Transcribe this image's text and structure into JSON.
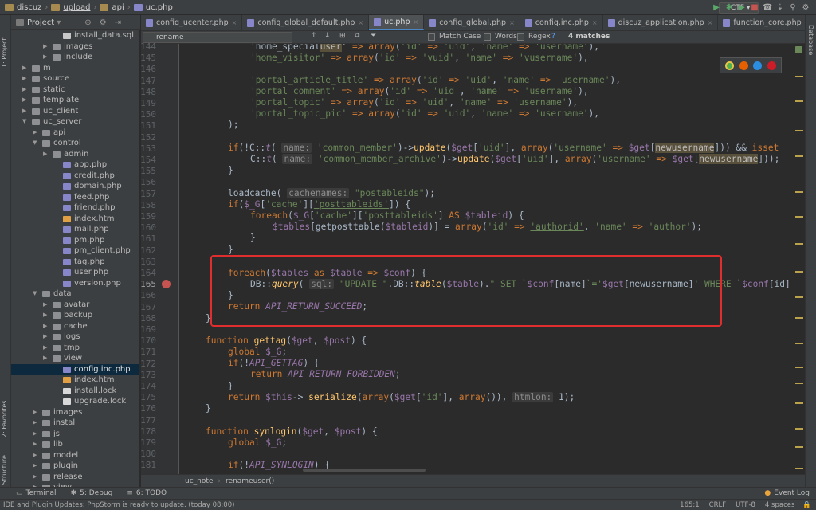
{
  "breadcrumbs": [
    "discuz",
    "upload",
    "api",
    "uc.php"
  ],
  "run_config": "CTF",
  "left_tools": {
    "project": "1: Project",
    "favorites": "2: Favorites",
    "structure": "Z: Structure"
  },
  "right_tools": {
    "database": "Database"
  },
  "project_panel": {
    "title": "Project"
  },
  "tree": [
    {
      "label": "install_data.sql",
      "depth": 5,
      "type": "sql"
    },
    {
      "label": "images",
      "depth": 4,
      "type": "folder",
      "arrow": "▶"
    },
    {
      "label": "include",
      "depth": 4,
      "type": "folder",
      "arrow": "▶"
    },
    {
      "label": "m",
      "depth": 2,
      "type": "folder",
      "arrow": "▶"
    },
    {
      "label": "source",
      "depth": 2,
      "type": "folder",
      "arrow": "▶"
    },
    {
      "label": "static",
      "depth": 2,
      "type": "folder",
      "arrow": "▶"
    },
    {
      "label": "template",
      "depth": 2,
      "type": "folder",
      "arrow": "▶"
    },
    {
      "label": "uc_client",
      "depth": 2,
      "type": "folder",
      "arrow": "▶"
    },
    {
      "label": "uc_server",
      "depth": 2,
      "type": "folder",
      "arrow": "▼"
    },
    {
      "label": "api",
      "depth": 3,
      "type": "folder",
      "arrow": "▶"
    },
    {
      "label": "control",
      "depth": 3,
      "type": "folder",
      "arrow": "▼"
    },
    {
      "label": "admin",
      "depth": 4,
      "type": "folder",
      "arrow": "▶"
    },
    {
      "label": "app.php",
      "depth": 5,
      "type": "php"
    },
    {
      "label": "credit.php",
      "depth": 5,
      "type": "php"
    },
    {
      "label": "domain.php",
      "depth": 5,
      "type": "php"
    },
    {
      "label": "feed.php",
      "depth": 5,
      "type": "php"
    },
    {
      "label": "friend.php",
      "depth": 5,
      "type": "php"
    },
    {
      "label": "index.htm",
      "depth": 5,
      "type": "htm"
    },
    {
      "label": "mail.php",
      "depth": 5,
      "type": "php"
    },
    {
      "label": "pm.php",
      "depth": 5,
      "type": "php"
    },
    {
      "label": "pm_client.php",
      "depth": 5,
      "type": "php"
    },
    {
      "label": "tag.php",
      "depth": 5,
      "type": "php"
    },
    {
      "label": "user.php",
      "depth": 5,
      "type": "php"
    },
    {
      "label": "version.php",
      "depth": 5,
      "type": "php"
    },
    {
      "label": "data",
      "depth": 3,
      "type": "folder",
      "arrow": "▼"
    },
    {
      "label": "avatar",
      "depth": 4,
      "type": "folder",
      "arrow": "▶"
    },
    {
      "label": "backup",
      "depth": 4,
      "type": "folder",
      "arrow": "▶"
    },
    {
      "label": "cache",
      "depth": 4,
      "type": "folder",
      "arrow": "▶"
    },
    {
      "label": "logs",
      "depth": 4,
      "type": "folder",
      "arrow": "▶"
    },
    {
      "label": "tmp",
      "depth": 4,
      "type": "folder",
      "arrow": "▶"
    },
    {
      "label": "view",
      "depth": 4,
      "type": "folder",
      "arrow": "▶"
    },
    {
      "label": "config.inc.php",
      "depth": 5,
      "type": "php",
      "selected": true
    },
    {
      "label": "index.htm",
      "depth": 5,
      "type": "htm"
    },
    {
      "label": "install.lock",
      "depth": 5,
      "type": "file"
    },
    {
      "label": "upgrade.lock",
      "depth": 5,
      "type": "file"
    },
    {
      "label": "images",
      "depth": 3,
      "type": "folder",
      "arrow": "▶"
    },
    {
      "label": "install",
      "depth": 3,
      "type": "folder",
      "arrow": "▶"
    },
    {
      "label": "js",
      "depth": 3,
      "type": "folder",
      "arrow": "▶"
    },
    {
      "label": "lib",
      "depth": 3,
      "type": "folder",
      "arrow": "▶"
    },
    {
      "label": "model",
      "depth": 3,
      "type": "folder",
      "arrow": "▶"
    },
    {
      "label": "plugin",
      "depth": 3,
      "type": "folder",
      "arrow": "▶"
    },
    {
      "label": "release",
      "depth": 3,
      "type": "folder",
      "arrow": "▶"
    },
    {
      "label": "view",
      "depth": 3,
      "type": "folder",
      "arrow": "▶"
    }
  ],
  "tabs": [
    {
      "label": "config_ucenter.php",
      "active": false
    },
    {
      "label": "config_global_default.php",
      "active": false
    },
    {
      "label": "uc.php",
      "active": true
    },
    {
      "label": "config_global.php",
      "active": false
    },
    {
      "label": "config.inc.php",
      "active": false
    },
    {
      "label": "discuz_application.php",
      "active": false
    },
    {
      "label": "function_core.php",
      "active": false
    }
  ],
  "find": {
    "query": "rename",
    "match_case": "Match Case",
    "words": "Words",
    "regex": "Regex",
    "regex_hint": "?",
    "matches": "4 matches"
  },
  "line_numbers": [
    "144",
    "145",
    "146",
    "147",
    "148",
    "149",
    "150",
    "151",
    "152",
    "153",
    "154",
    "155",
    "156",
    "157",
    "158",
    "159",
    "160",
    "161",
    "162",
    "163",
    "164",
    "165",
    "166",
    "167",
    "168",
    "169",
    "170",
    "171",
    "172",
    "173",
    "174",
    "175",
    "176",
    "177",
    "178",
    "179",
    "180",
    "181"
  ],
  "current_line": "165",
  "bottom_crumbs": [
    "uc_note",
    "renameuser()"
  ],
  "tool_windows": [
    "Terminal",
    "5: Debug",
    "6: TODO"
  ],
  "event_log": "Event Log",
  "status": {
    "message": "IDE and Plugin Updates: PhpStorm is ready to update. (today 08:00)",
    "position": "165:1",
    "line_sep": "CRLF",
    "encoding": "UTF-8",
    "indent": "4 spaces"
  },
  "colors": {
    "accent": "#4a88c7",
    "highlight_box": "#e02d2d",
    "breakpoint": "#c75450"
  }
}
